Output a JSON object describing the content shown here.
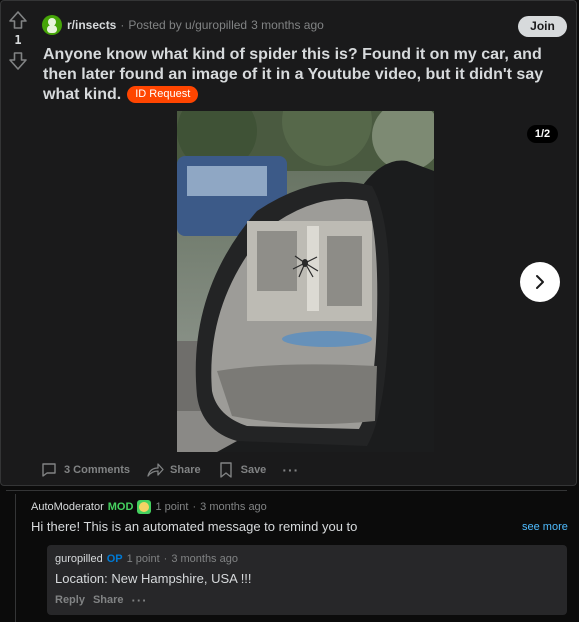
{
  "post": {
    "vote_count": "1",
    "subreddit": "r/insects",
    "posted_by": "Posted by u/guropilled",
    "age": "3 months ago",
    "join_label": "Join",
    "title": "Anyone know what kind of spider this is? Found it on my car, and then later found an image of it in a Youtube video, but it didn't say what kind.",
    "flair": "ID Request",
    "media_counter": "1/2"
  },
  "actions": {
    "comments": "3 Comments",
    "share": "Share",
    "save": "Save",
    "more": "···"
  },
  "comments": [
    {
      "author": "AutoModerator",
      "badge": "MOD",
      "points": "1 point",
      "age": "3 months ago",
      "body": "Hi there! This is an automated message to remind you to",
      "see_more": "see more"
    },
    {
      "author": "guropilled",
      "badge": "OP",
      "points": "1 point",
      "age": "3 months ago",
      "body": "Location: New Hampshire, USA !!!",
      "reply": "Reply",
      "share": "Share",
      "more": "···"
    }
  ],
  "colors": {
    "accent": "#ff4500",
    "link": "#4fbcff",
    "mod_badge": "#46d160",
    "op_badge": "#0079d3"
  }
}
